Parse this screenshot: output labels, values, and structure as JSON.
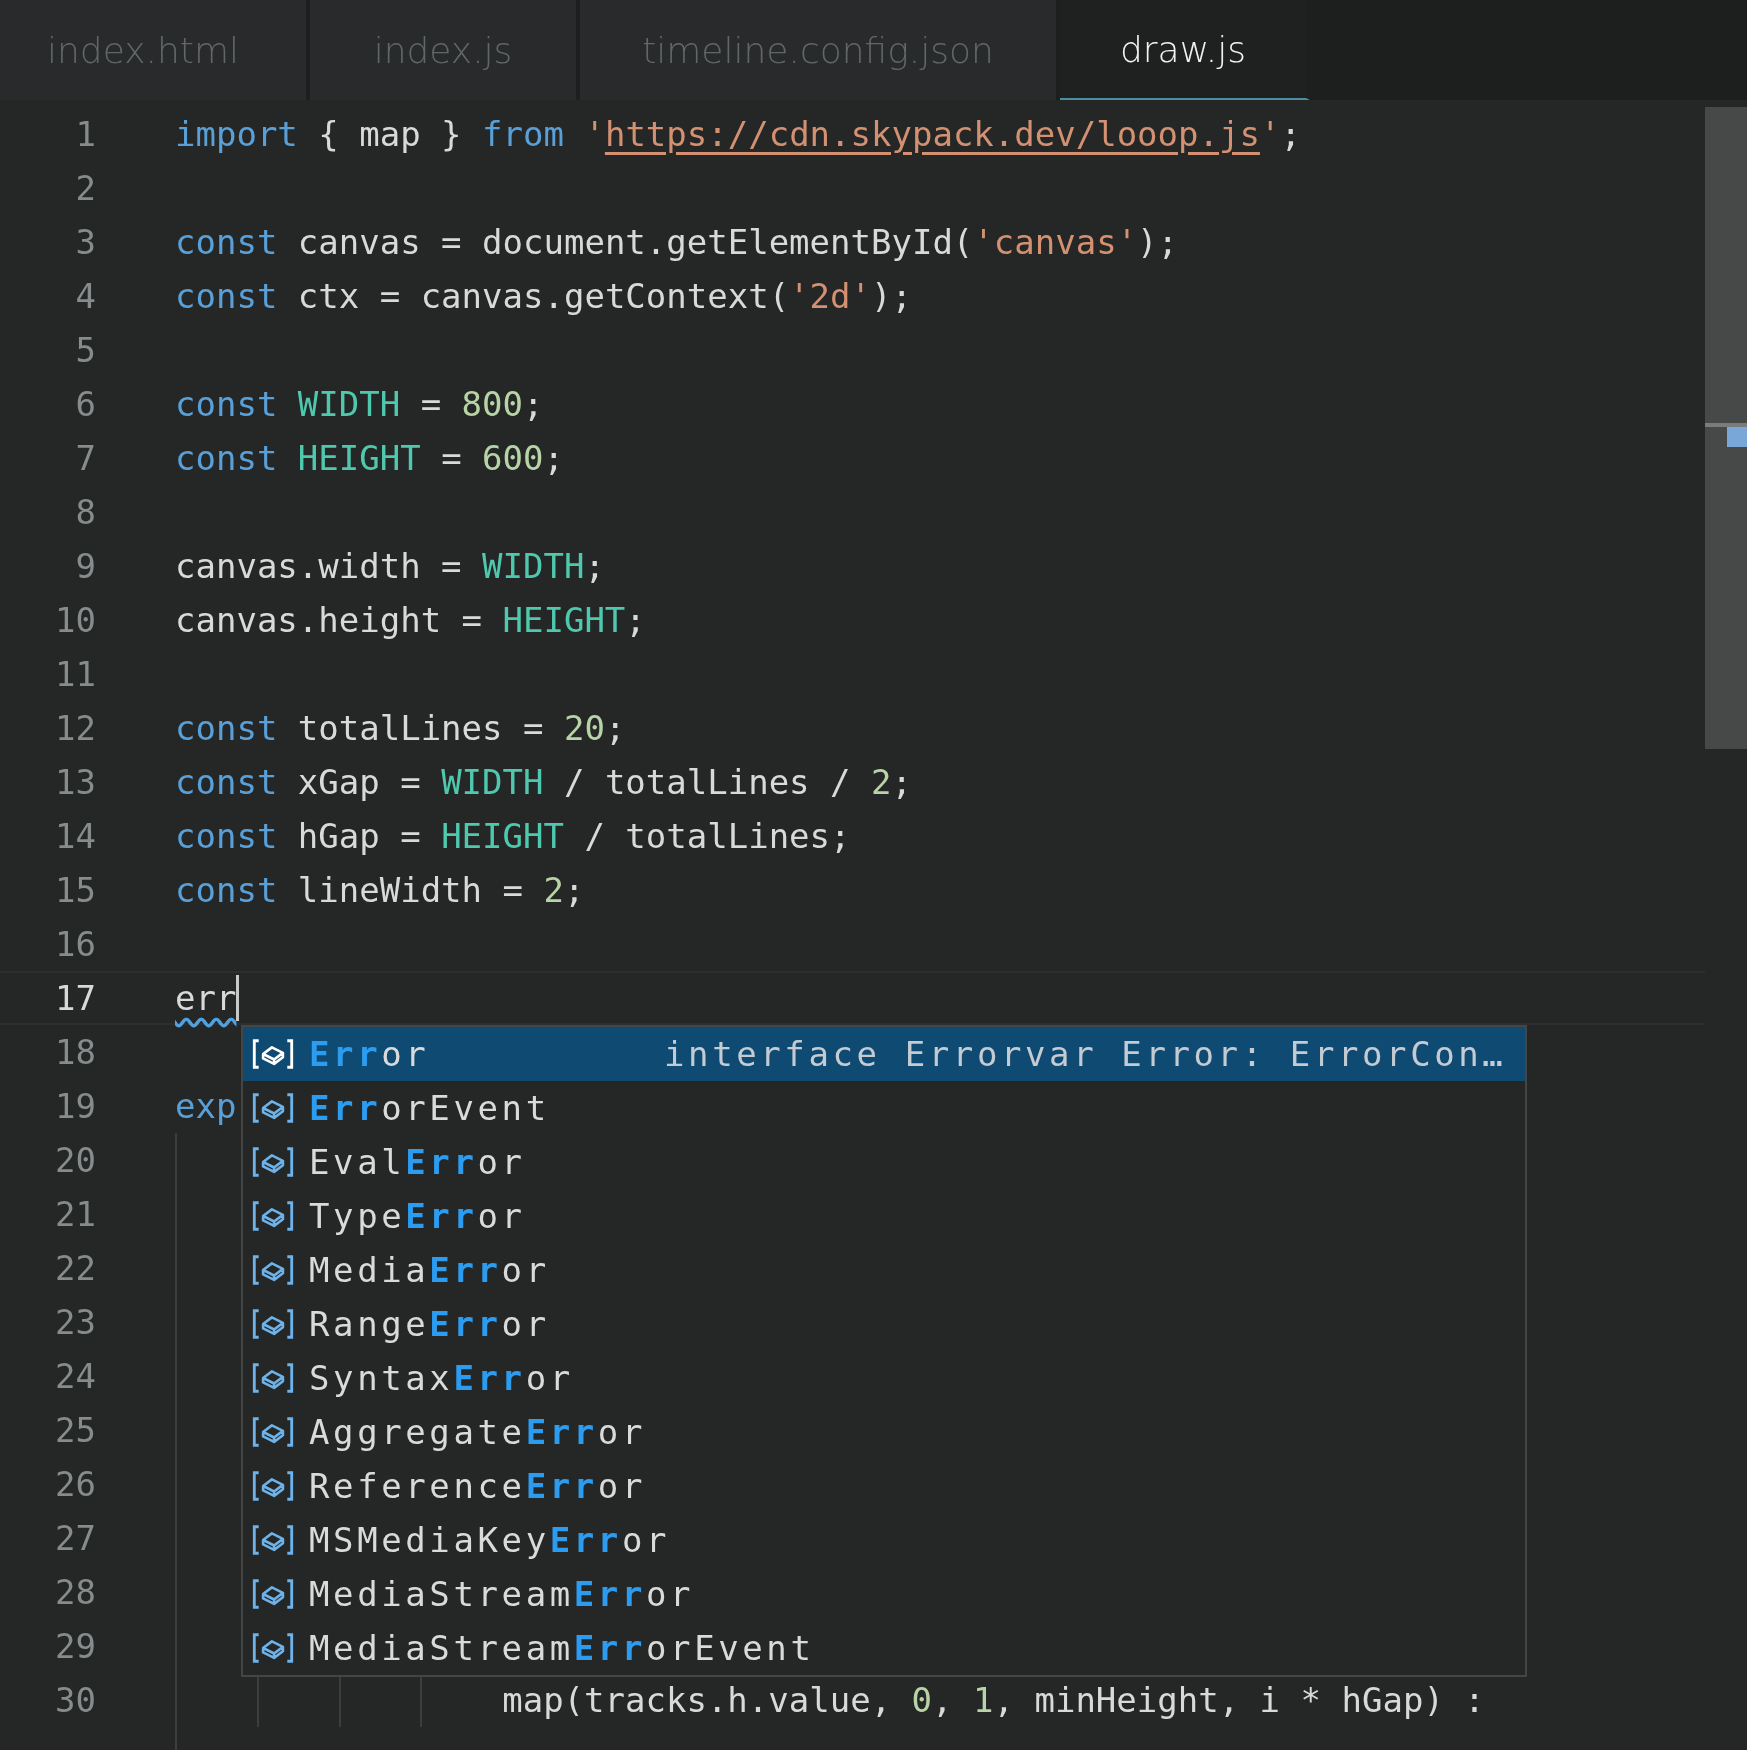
{
  "tabs": [
    {
      "label": "index.html",
      "selected": false
    },
    {
      "label": "index.js",
      "selected": false
    },
    {
      "label": "timeline.config.json",
      "selected": false
    },
    {
      "label": "draw.js",
      "selected": true
    }
  ],
  "lines": [
    {
      "number": "1",
      "kind": "code",
      "cursor": false,
      "tokens": [
        {
          "kind": "keyword",
          "text": "import"
        },
        {
          "kind": "plain",
          "text": " { map } "
        },
        {
          "kind": "keyword",
          "text": "from"
        },
        {
          "kind": "string",
          "text": " '"
        },
        {
          "kind": "link",
          "text": "https://cdn.skypack.dev/looop.js"
        },
        {
          "kind": "string",
          "text": "'"
        },
        {
          "kind": "plain",
          "text": ";"
        }
      ]
    },
    {
      "number": "2",
      "kind": "code",
      "cursor": false
    },
    {
      "number": "3",
      "kind": "code",
      "cursor": false,
      "tokens": [
        {
          "kind": "keyword",
          "text": "const"
        },
        {
          "kind": "plain",
          "text": " canvas = document.getElementById("
        },
        {
          "kind": "string",
          "text": "'canvas'"
        },
        {
          "kind": "plain",
          "text": ");"
        }
      ]
    },
    {
      "number": "4",
      "kind": "code",
      "cursor": false,
      "tokens": [
        {
          "kind": "keyword",
          "text": "const"
        },
        {
          "kind": "plain",
          "text": " ctx = canvas.getContext("
        },
        {
          "kind": "string",
          "text": "'2d'"
        },
        {
          "kind": "plain",
          "text": ");"
        }
      ]
    },
    {
      "number": "5",
      "kind": "code",
      "cursor": false
    },
    {
      "number": "6",
      "kind": "code",
      "cursor": false,
      "tokens": [
        {
          "kind": "keyword",
          "text": "const "
        },
        {
          "kind": "constant",
          "text": "WIDTH"
        },
        {
          "kind": "plain",
          "text": " = "
        },
        {
          "kind": "number",
          "text": "800"
        },
        {
          "kind": "plain",
          "text": ";"
        }
      ]
    },
    {
      "number": "7",
      "kind": "code",
      "cursor": false,
      "tokens": [
        {
          "kind": "keyword",
          "text": "const "
        },
        {
          "kind": "constant",
          "text": "HEIGHT"
        },
        {
          "kind": "plain",
          "text": " = "
        },
        {
          "kind": "number",
          "text": "600"
        },
        {
          "kind": "plain",
          "text": ";"
        }
      ]
    },
    {
      "number": "8",
      "kind": "code",
      "cursor": false
    },
    {
      "number": "9",
      "kind": "code",
      "cursor": false,
      "tokens": [
        {
          "kind": "plain",
          "text": "canvas.width = "
        },
        {
          "kind": "constant",
          "text": "WIDTH"
        },
        {
          "kind": "plain",
          "text": ";"
        }
      ]
    },
    {
      "number": "10",
      "kind": "code",
      "cursor": false,
      "tokens": [
        {
          "kind": "plain",
          "text": "canvas.height = "
        },
        {
          "kind": "constant",
          "text": "HEIGHT"
        },
        {
          "kind": "plain",
          "text": ";"
        }
      ]
    },
    {
      "number": "11",
      "kind": "code",
      "cursor": false
    },
    {
      "number": "12",
      "kind": "code",
      "cursor": false,
      "tokens": [
        {
          "kind": "keyword",
          "text": "const"
        },
        {
          "kind": "plain",
          "text": " totalLines = "
        },
        {
          "kind": "number",
          "text": "20"
        },
        {
          "kind": "plain",
          "text": ";"
        }
      ]
    },
    {
      "number": "13",
      "kind": "code",
      "cursor": false,
      "tokens": [
        {
          "kind": "keyword",
          "text": "const"
        },
        {
          "kind": "plain",
          "text": " xGap = "
        },
        {
          "kind": "constant",
          "text": "WIDTH"
        },
        {
          "kind": "plain",
          "text": " / totalLines / "
        },
        {
          "kind": "number",
          "text": "2"
        },
        {
          "kind": "plain",
          "text": ";"
        }
      ]
    },
    {
      "number": "14",
      "kind": "code",
      "cursor": false,
      "tokens": [
        {
          "kind": "keyword",
          "text": "const"
        },
        {
          "kind": "plain",
          "text": " hGap = "
        },
        {
          "kind": "constant",
          "text": "HEIGHT"
        },
        {
          "kind": "plain",
          "text": " / totalLines;"
        }
      ]
    },
    {
      "number": "15",
      "kind": "code",
      "cursor": false,
      "tokens": [
        {
          "kind": "keyword",
          "text": "const"
        },
        {
          "kind": "plain",
          "text": " lineWidth = "
        },
        {
          "kind": "number",
          "text": "2"
        },
        {
          "kind": "plain",
          "text": ";"
        }
      ]
    },
    {
      "number": "16",
      "kind": "code",
      "cursor": false
    },
    {
      "number": "17",
      "kind": "code",
      "cursor": true,
      "tokens": [
        {
          "kind": "warning",
          "text": "err"
        }
      ]
    },
    {
      "number": "18",
      "kind": "code",
      "cursor": false
    },
    {
      "number": "19",
      "kind": "code",
      "cursor": false,
      "tokens": [
        {
          "kind": "keyword",
          "text": "exp"
        }
      ]
    },
    {
      "number": "20",
      "kind": "code",
      "cursor": false
    },
    {
      "number": "21",
      "kind": "code",
      "cursor": false
    },
    {
      "number": "22",
      "kind": "code",
      "cursor": false
    },
    {
      "number": "23",
      "kind": "code",
      "cursor": false
    },
    {
      "number": "24",
      "kind": "code",
      "cursor": false
    },
    {
      "number": "25",
      "kind": "code",
      "cursor": false
    },
    {
      "number": "26",
      "kind": "code",
      "cursor": false
    },
    {
      "number": "27",
      "kind": "code",
      "cursor": false
    },
    {
      "number": "28",
      "kind": "code",
      "cursor": false
    },
    {
      "number": "29",
      "kind": "code",
      "cursor": false
    },
    {
      "number": "30",
      "kind": "nested",
      "cursor": false,
      "tokens": [
        {
          "kind": "plain",
          "text": "map(tracks.h.value, "
        },
        {
          "kind": "number",
          "text": "0"
        },
        {
          "kind": "plain",
          "text": ", "
        },
        {
          "kind": "number",
          "text": "1"
        },
        {
          "kind": "plain",
          "text": ", minHeight, i * hGap) :"
        }
      ]
    }
  ],
  "suggestions": [
    {
      "label": "**Err**or",
      "selected": true,
      "detail": "interface Errorvar Error: ErrorCon…"
    },
    {
      "label": "**Err**orEvent",
      "selected": false
    },
    {
      "label": "Eval**Err**or",
      "selected": false
    },
    {
      "label": "Type**Err**or",
      "selected": false
    },
    {
      "label": "Media**Err**or",
      "selected": false
    },
    {
      "label": "Range**Err**or",
      "selected": false
    },
    {
      "label": "Syntax**Err**or",
      "selected": false
    },
    {
      "label": "Aggregate**Err**or",
      "selected": false
    },
    {
      "label": "Reference**Err**or",
      "selected": false
    },
    {
      "label": "MSMediaKey**Err**or",
      "selected": false
    },
    {
      "label": "MediaStream**Err**or",
      "selected": false
    },
    {
      "label": "MediaStream**Err**orEvent",
      "selected": false
    }
  ]
}
